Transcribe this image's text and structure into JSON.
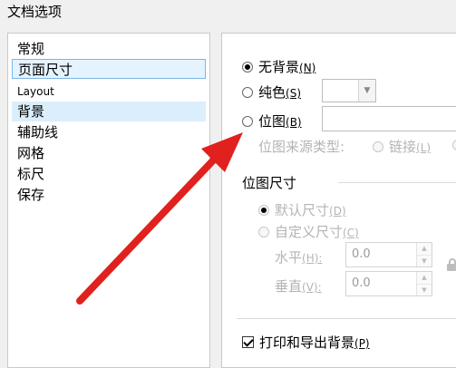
{
  "dialog": {
    "title": "文档选项"
  },
  "sidebar": {
    "items": [
      {
        "label": "常规"
      },
      {
        "label": "页面尺寸"
      },
      {
        "label": "Layout"
      },
      {
        "label": "背景"
      },
      {
        "label": "辅助线"
      },
      {
        "label": "网格"
      },
      {
        "label": "标尺"
      },
      {
        "label": "保存"
      }
    ]
  },
  "background": {
    "none": {
      "label": "无背景",
      "key": "(N)",
      "selected": true
    },
    "solid": {
      "label": "纯色",
      "key": "(S)",
      "selected": false
    },
    "bitmap": {
      "label": "位图",
      "key": "(B)",
      "selected": false,
      "value": ""
    },
    "source_label": "位图来源类型:",
    "source_link": {
      "label": "链接",
      "key": "(L)"
    }
  },
  "bitmap_size": {
    "header": "位图尺寸",
    "default": {
      "label": "默认尺寸",
      "key": "(D)",
      "selected": true
    },
    "custom": {
      "label": "自定义尺寸",
      "key": "(C)",
      "selected": false
    },
    "horizontal": {
      "label": "水平",
      "key": "(H):",
      "value": "0.0"
    },
    "vertical": {
      "label": "垂直",
      "key": "(V):",
      "value": "0.0"
    }
  },
  "print_export": {
    "label": "打印和导出背景",
    "key": "(P)",
    "checked": true
  },
  "arrow": {
    "color": "#e0211e"
  }
}
